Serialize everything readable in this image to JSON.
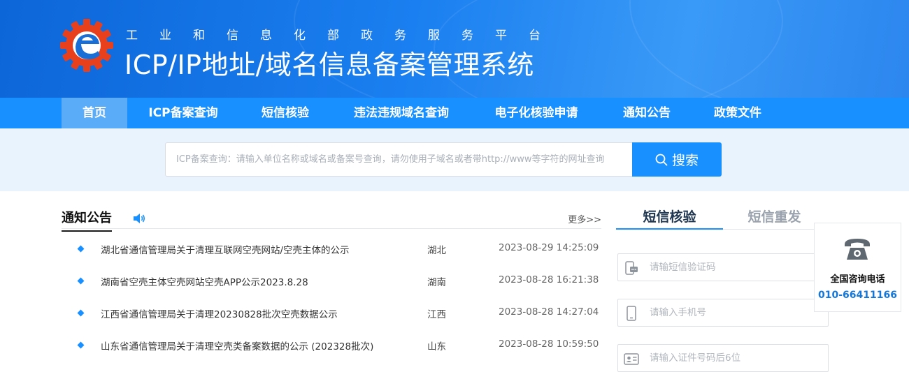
{
  "header": {
    "subtitle": "工业和信息化部政务服务平台",
    "title": "ICP/IP地址/域名信息备案管理系统"
  },
  "nav": {
    "items": [
      {
        "label": "首页",
        "active": true
      },
      {
        "label": "ICP备案查询",
        "active": false
      },
      {
        "label": "短信核验",
        "active": false
      },
      {
        "label": "违法违规域名查询",
        "active": false
      },
      {
        "label": "电子化核验申请",
        "active": false
      },
      {
        "label": "通知公告",
        "active": false
      },
      {
        "label": "政策文件",
        "active": false
      }
    ]
  },
  "search": {
    "placeholder": "ICP备案查询：请输入单位名称或域名或备案号查询，请勿使用子域名或者带http://www等字符的网址查询",
    "button_label": "搜索"
  },
  "notices": {
    "title": "通知公告",
    "more_label": "更多>>",
    "items": [
      {
        "text": "湖北省通信管理局关于清理互联网空壳网站/空壳主体的公示",
        "province": "湖北",
        "time": "2023-08-29 14:25:09"
      },
      {
        "text": "湖南省空壳主体空壳网站空壳APP公示2023.8.28",
        "province": "湖南",
        "time": "2023-08-28 16:21:38"
      },
      {
        "text": "江西省通信管理局关于清理20230828批次空壳数据公示",
        "province": "江西",
        "time": "2023-08-28 14:27:04"
      },
      {
        "text": "山东省通信管理局关于清理空壳类备案数据的公示 (202328批次)",
        "province": "山东",
        "time": "2023-08-28 10:59:50"
      }
    ]
  },
  "sms": {
    "tab_active": "短信核验",
    "tab_inactive": "短信重发",
    "code_placeholder": "请输短信验证码",
    "phone_placeholder": "请输入手机号",
    "id_placeholder": "请输入证件号码后6位"
  },
  "hotline": {
    "label": "全国咨询电话",
    "number": "010-66411166"
  },
  "colors": {
    "primary": "#1890ff",
    "nav_active": "#5aacf8",
    "search_band": "#e8f3fd",
    "hotline_number": "#1377d9"
  }
}
